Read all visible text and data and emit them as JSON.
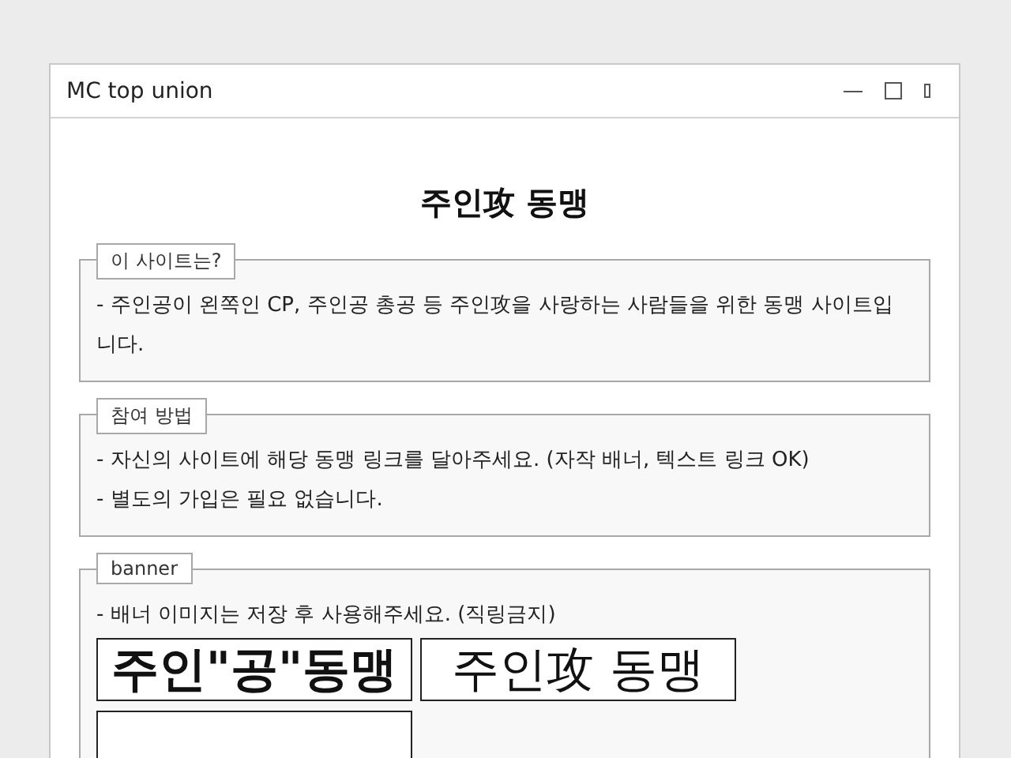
{
  "window": {
    "title": "MC top union"
  },
  "heading": "주인攻 동맹",
  "sections": [
    {
      "legend": "이 사이트는?",
      "lines": [
        "- 주인공이 왼쪽인 CP, 주인공 총공 등 주인攻을 사랑하는 사람들을 위한 동맹 사이트입니다."
      ]
    },
    {
      "legend": "참여 방법",
      "lines": [
        "- 자신의 사이트에 해당 동맹 링크를 달아주세요. (자작 배너, 텍스트 링크 OK)",
        "- 별도의 가입은 필요 없습니다."
      ]
    },
    {
      "legend": "banner",
      "lines": [
        "- 배너 이미지는 저장 후 사용해주세요. (직링금지)"
      ],
      "banners": [
        {
          "text": "주인\"공\"동맹",
          "kind": "bold"
        },
        {
          "text": "주인攻 동맹",
          "kind": "brush"
        },
        {
          "kind": "cut"
        }
      ]
    }
  ]
}
